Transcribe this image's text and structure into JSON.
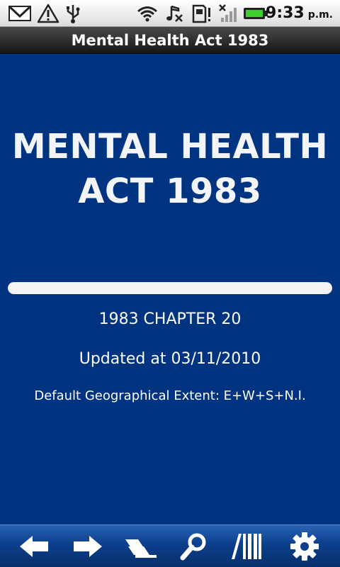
{
  "status_bar": {
    "time": "9:33",
    "ampm": "p.m."
  },
  "title_bar": {
    "title": "Mental Health Act 1983"
  },
  "document": {
    "title_line1": "MENTAL HEALTH",
    "title_line2": "ACT 1983",
    "chapter": "1983 CHAPTER 20",
    "updated": "Updated at 03/11/2010",
    "extent": "Default Geographical Extent: E+W+S+N.I."
  },
  "toolbar": {
    "buttons": [
      "back-arrow-icon",
      "forward-arrow-icon",
      "contents-icon",
      "search-icon",
      "library-icon",
      "settings-gear-icon"
    ]
  },
  "colors": {
    "background": "#003380",
    "title_bar": "#222222",
    "toolbar": "#0b3f8d",
    "text": "#ffffff"
  }
}
